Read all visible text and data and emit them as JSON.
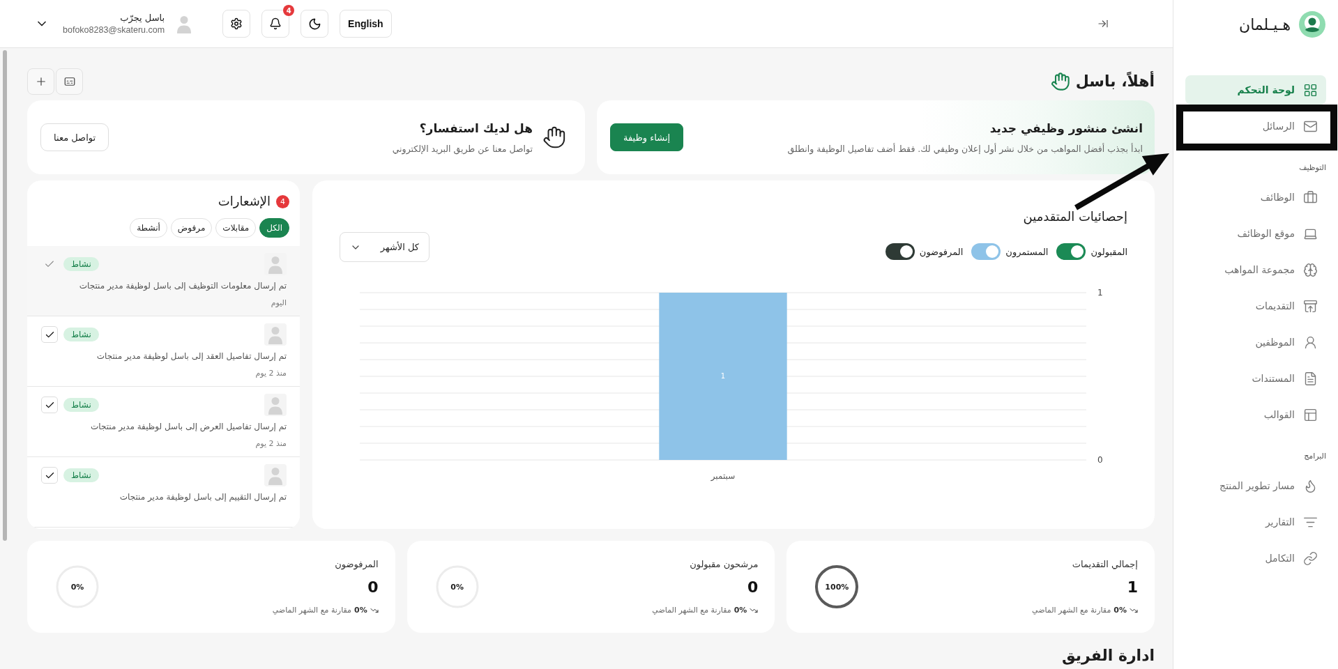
{
  "top_bar": {
    "language": "English",
    "notification_count": "4",
    "user": {
      "name": "باسل يجرّب",
      "email": "bofoko8283@skateru.com"
    }
  },
  "sidebar": {
    "logo": "هـيـلمان",
    "groups": [
      {
        "items": [
          {
            "label": "لوحة التحكم",
            "selected": true
          },
          {
            "label": "الرسائل",
            "selected": false
          }
        ]
      },
      {
        "title": "التوظيف",
        "items": [
          {
            "label": "الوظائف",
            "selected": false
          },
          {
            "label": "موقع الوظائف",
            "selected": false
          },
          {
            "label": "مجموعة المواهب",
            "selected": false
          },
          {
            "label": "التقديمات",
            "selected": false
          },
          {
            "label": "الموظفين",
            "selected": false
          },
          {
            "label": "المستندات",
            "selected": false
          },
          {
            "label": "القوالب",
            "selected": false
          }
        ]
      },
      {
        "title": "البرامج",
        "items": [
          {
            "label": "مسار تطوير المنتج",
            "selected": false
          },
          {
            "label": "التقارير",
            "selected": false
          },
          {
            "label": "التكامل",
            "selected": false
          }
        ]
      }
    ]
  },
  "greeting": "أهلاً، باسل",
  "banners": [
    {
      "kind": "job",
      "title": "انشئ منشور وظيفي جديد",
      "subtitle": "ابدأ بجذب أفضل المواهب من خلال نشر أول إعلان وظيفي لك. فقط أضف تفاصيل الوظيفة وانطلق",
      "button": "إنشاء وظيفة"
    },
    {
      "kind": "contact",
      "title": "هل لديك استفسار؟",
      "subtitle": "تواصل معنا عن طريق البريد الإلكتروني",
      "button": "تواصل معنا"
    }
  ],
  "applicant_stats": {
    "title": "إحصائيات المتقدمين",
    "series_toggles": [
      {
        "on": true
      },
      {
        "on": true
      },
      {
        "on": true
      }
    ],
    "period": "كل الأشهر",
    "chart_data": {
      "type": "bar",
      "categories": [
        "سبتمبر"
      ],
      "series": [
        {
          "name": "المقبولون",
          "color": "#1b8a55",
          "values": [
            0
          ]
        },
        {
          "name": "المستمرون",
          "color": "#8ec3e8",
          "values": [
            1
          ]
        },
        {
          "name": "المرفوضون",
          "color": "#2e3a35",
          "values": [
            0
          ]
        }
      ],
      "stacked": true,
      "ylim": [
        0,
        1
      ],
      "yticks": [
        0,
        1
      ],
      "value_labels": [
        [
          null
        ],
        [
          "1"
        ],
        [
          null
        ]
      ]
    }
  },
  "notifications": {
    "title": "الإشعارات",
    "count": "4",
    "filters": [
      {
        "label": "الكل",
        "selected": true
      },
      {
        "label": "مقابلات",
        "selected": false
      },
      {
        "label": "مرفوض",
        "selected": false
      },
      {
        "label": "أنشطة",
        "selected": false
      }
    ],
    "items": [
      {
        "tag": "نشاط",
        "text": "تم إرسال معلومات التوظيف إلى باسل لوظيفة مدير منتجات",
        "time": "اليوم",
        "read": true
      },
      {
        "tag": "نشاط",
        "text": "تم إرسال تفاصيل العقد إلى باسل لوظيفة مدير منتجات",
        "time": "منذ 2 يوم",
        "read": false
      },
      {
        "tag": "نشاط",
        "text": "تم إرسال تفاصيل العرض إلى باسل لوظيفة مدير منتجات",
        "time": "منذ 2 يوم",
        "read": false
      },
      {
        "tag": "نشاط",
        "text": "تم إرسال التقييم إلى باسل لوظيفة مدير منتجات",
        "read": false
      }
    ]
  },
  "stats": [
    {
      "title": "إجمالي التقديمات",
      "value": "1",
      "percent": "100%",
      "level": 1,
      "change": "0%",
      "comparison": "مقارنة مع الشهر الماضي"
    },
    {
      "title": "مرشحون مقبولون",
      "value": "0",
      "percent": "0%",
      "change": "0%",
      "comparison": "مقارنة مع الشهر الماضي"
    },
    {
      "title": "المرفوضون",
      "value": "0",
      "percent": "0%",
      "change": "0%",
      "comparison": "مقارنة مع الشهر الماضي"
    }
  ],
  "team_section": {
    "title": "ادارة الفريق"
  }
}
